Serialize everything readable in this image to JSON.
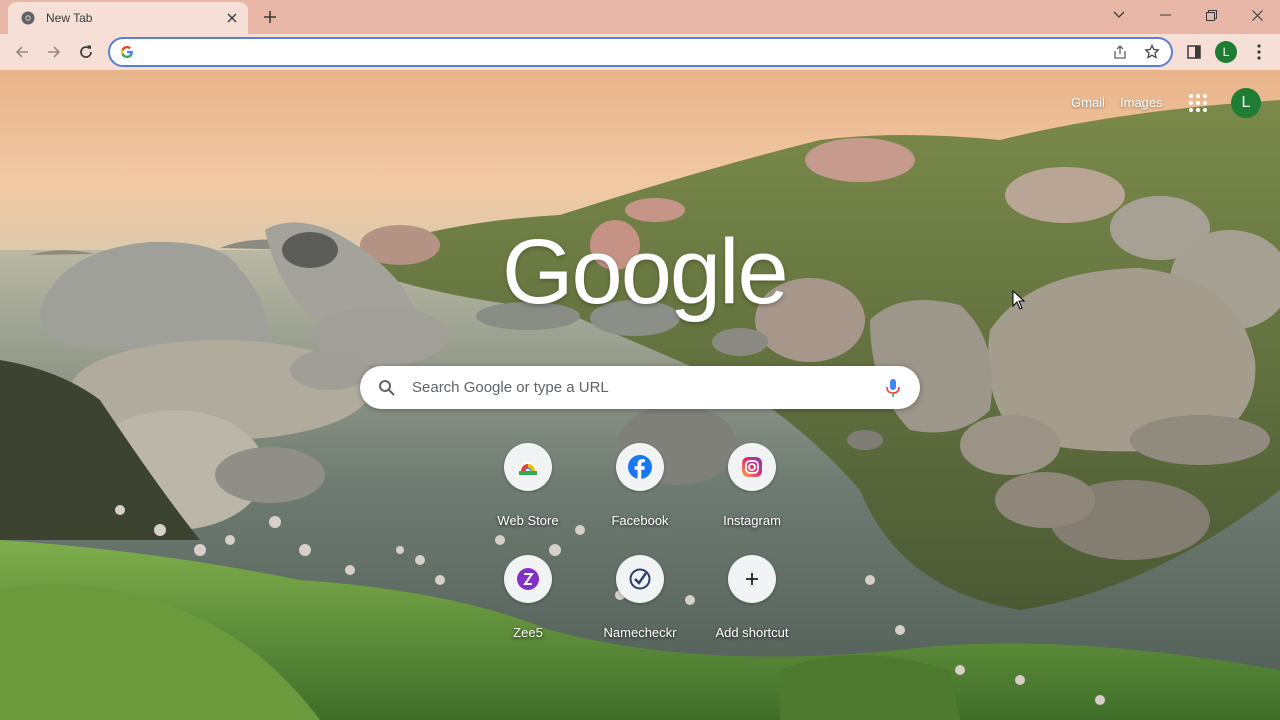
{
  "browser": {
    "tab_title": "New Tab",
    "omnibox_value": "",
    "profile_initial": "L"
  },
  "ntp": {
    "links": {
      "gmail": "Gmail",
      "images": "Images"
    },
    "profile_initial": "L",
    "logo": "Google",
    "search_placeholder": "Search Google or type a URL",
    "shortcuts": [
      {
        "label": "Web Store",
        "icon": "chrome-web-store-icon"
      },
      {
        "label": "Facebook",
        "icon": "facebook-icon"
      },
      {
        "label": "Instagram",
        "icon": "instagram-icon"
      },
      {
        "label": "Zee5",
        "icon": "zee5-icon"
      },
      {
        "label": "Namecheckr",
        "icon": "namecheckr-icon"
      },
      {
        "label": "Add shortcut",
        "icon": "plus-icon"
      }
    ]
  },
  "colors": {
    "titlebar": "#e8b6a6",
    "toolbar": "#f6dfd7",
    "omnibox_focus": "#5a7fd0",
    "profile": "#1e7d32"
  }
}
